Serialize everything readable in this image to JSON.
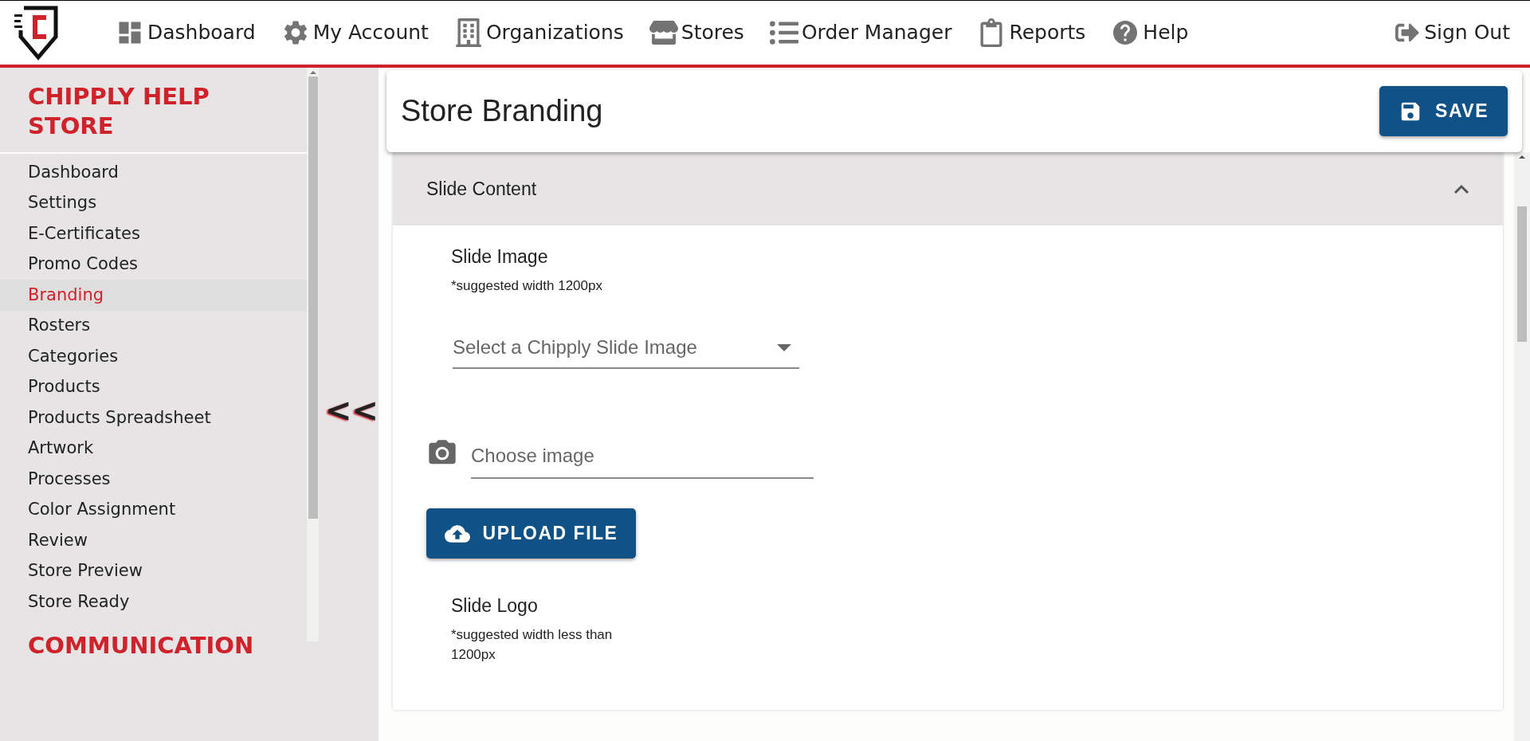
{
  "nav": {
    "items": [
      {
        "label": "Dashboard"
      },
      {
        "label": "My Account"
      },
      {
        "label": "Organizations"
      },
      {
        "label": "Stores"
      },
      {
        "label": "Order Manager"
      },
      {
        "label": "Reports"
      },
      {
        "label": "Help"
      }
    ],
    "sign_out": "Sign Out"
  },
  "sidebar": {
    "title": "CHIPPLY HELP STORE",
    "items": [
      {
        "label": "Dashboard",
        "selected": false
      },
      {
        "label": "Settings",
        "selected": false
      },
      {
        "label": "E-Certificates",
        "selected": false
      },
      {
        "label": "Promo Codes",
        "selected": false
      },
      {
        "label": "Branding",
        "selected": true
      },
      {
        "label": "Rosters",
        "selected": false
      },
      {
        "label": "Categories",
        "selected": false
      },
      {
        "label": "Products",
        "selected": false
      },
      {
        "label": "Products Spreadsheet",
        "selected": false
      },
      {
        "label": "Artwork",
        "selected": false
      },
      {
        "label": "Processes",
        "selected": false
      },
      {
        "label": "Color Assignment",
        "selected": false
      },
      {
        "label": "Review",
        "selected": false
      },
      {
        "label": "Store Preview",
        "selected": false
      },
      {
        "label": "Store Ready",
        "selected": false
      }
    ],
    "section_title": "COMMUNICATION",
    "collapse": "<<"
  },
  "page": {
    "title": "Store Branding",
    "save": "SAVE"
  },
  "section": {
    "title": "Slide Content",
    "expanded": true,
    "slide_image": {
      "label": "Slide Image",
      "hint": "*suggested width 1200px",
      "select_placeholder": "Select a Chipply Slide Image",
      "file_placeholder": "Choose image",
      "upload": "UPLOAD FILE"
    },
    "slide_logo": {
      "label": "Slide Logo",
      "hint": "*suggested width less than 1200px"
    }
  }
}
